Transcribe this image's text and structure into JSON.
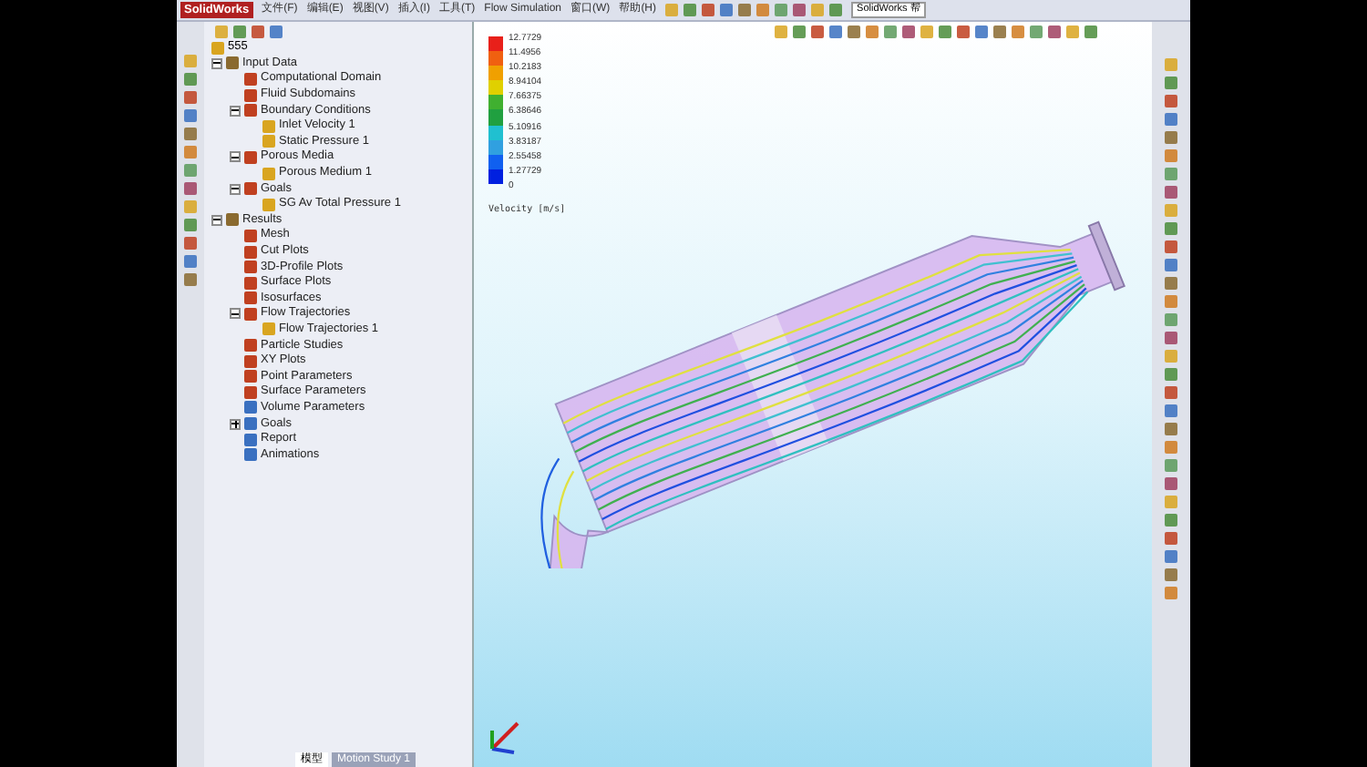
{
  "menu_bar": {
    "app_name": "SolidWorks",
    "items": [
      "文件(F)",
      "编辑(E)",
      "视图(V)",
      "插入(I)",
      "工具(T)",
      "Flow Simulation",
      "窗口(W)",
      "帮助(H)"
    ],
    "search": {
      "value": "SolidWorks 帮"
    }
  },
  "tree": {
    "root": "555",
    "items": [
      {
        "label": "Input Data",
        "expanded": true,
        "children": [
          {
            "label": "Computational Domain"
          },
          {
            "label": "Fluid Subdomains"
          },
          {
            "label": "Boundary Conditions",
            "expanded": true,
            "children": [
              {
                "label": "Inlet Velocity 1"
              },
              {
                "label": "Static Pressure 1"
              }
            ]
          },
          {
            "label": "Porous Media",
            "expanded": true,
            "children": [
              {
                "label": "Porous Medium 1"
              }
            ]
          },
          {
            "label": "Goals",
            "expanded": true,
            "children": [
              {
                "label": "SG Av Total Pressure 1"
              }
            ]
          }
        ]
      },
      {
        "label": "Results",
        "expanded": true,
        "children": [
          {
            "label": "Mesh"
          },
          {
            "label": "Cut Plots"
          },
          {
            "label": "3D-Profile Plots"
          },
          {
            "label": "Surface Plots"
          },
          {
            "label": "Isosurfaces"
          },
          {
            "label": "Flow Trajectories",
            "expanded": true,
            "children": [
              {
                "label": "Flow Trajectories 1"
              }
            ]
          },
          {
            "label": "Particle Studies"
          },
          {
            "label": "XY Plots"
          },
          {
            "label": "Point Parameters"
          },
          {
            "label": "Surface Parameters"
          },
          {
            "label": "Volume Parameters"
          },
          {
            "label": "Goals",
            "expanded": false
          },
          {
            "label": "Report"
          },
          {
            "label": "Animations"
          }
        ]
      }
    ]
  },
  "legend": {
    "title": "Velocity [m/s]",
    "ticks": [
      "12.7729",
      "11.4956",
      "10.2183",
      "8.94104",
      "7.66375",
      "6.38646",
      "5.10916",
      "3.83187",
      "2.55458",
      "1.27729",
      "0"
    ]
  },
  "bottom_tabs": [
    {
      "label": "模型",
      "selected": true
    },
    {
      "label": "Motion Study 1",
      "selected": false
    }
  ]
}
